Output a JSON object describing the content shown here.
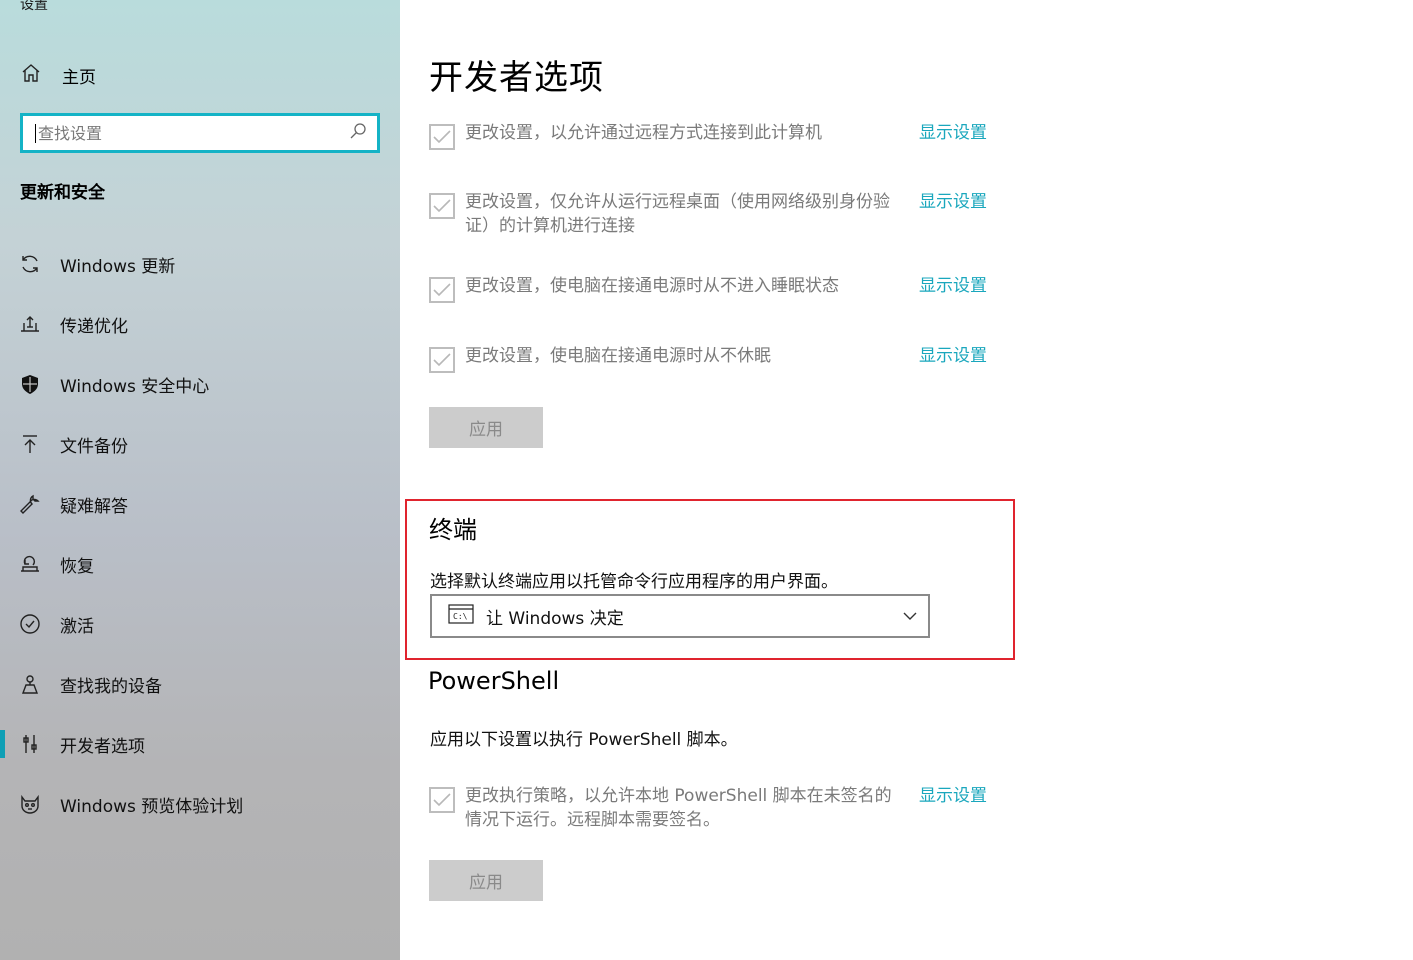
{
  "sidebar": {
    "app_title": "设置",
    "home_label": "主页",
    "search_placeholder": "查找设置",
    "section_title": "更新和安全",
    "items": [
      {
        "label": "Windows 更新",
        "icon": "sync-icon"
      },
      {
        "label": "传递优化",
        "icon": "delivery-optimization-icon"
      },
      {
        "label": "Windows 安全中心",
        "icon": "shield-icon"
      },
      {
        "label": "文件备份",
        "icon": "backup-arrow-up-icon"
      },
      {
        "label": "疑难解答",
        "icon": "wrench-icon"
      },
      {
        "label": "恢复",
        "icon": "recovery-icon"
      },
      {
        "label": "激活",
        "icon": "check-circle-icon"
      },
      {
        "label": "查找我的设备",
        "icon": "find-device-icon"
      },
      {
        "label": "开发者选项",
        "icon": "developer-sliders-icon",
        "active": true
      },
      {
        "label": "Windows 预览体验计划",
        "icon": "insider-cat-icon"
      }
    ],
    "accent": "#0f9fb5"
  },
  "main": {
    "title": "开发者选项",
    "remote_settings": [
      {
        "text": "更改设置，以允许通过远程方式连接到此计算机",
        "link": "显示设置",
        "checked": true
      },
      {
        "text": "更改设置，仅允许从运行远程桌面（使用网络级别身份验证）的计算机进行连接",
        "link": "显示设置",
        "checked": true
      },
      {
        "text": "更改设置，使电脑在接通电源时从不进入睡眠状态",
        "link": "显示设置",
        "checked": true
      },
      {
        "text": "更改设置，使电脑在接通电源时从不休眠",
        "link": "显示设置",
        "checked": true
      }
    ],
    "apply_label": "应用",
    "terminal": {
      "title": "终端",
      "description": "选择默认终端应用以托管命令行应用程序的用户界面。",
      "selected": "让 Windows 决定",
      "icon": "console-icon"
    },
    "powershell": {
      "title": "PowerShell",
      "description": "应用以下设置以执行 PowerShell 脚本。",
      "setting": {
        "text": "更改执行策略，以允许本地 PowerShell 脚本在未签名的情况下运行。远程脚本需要签名。",
        "link": "显示设置",
        "checked": true
      },
      "apply_label": "应用"
    },
    "link_color": "#1aa7bd",
    "highlight_color": "#e0242e"
  }
}
